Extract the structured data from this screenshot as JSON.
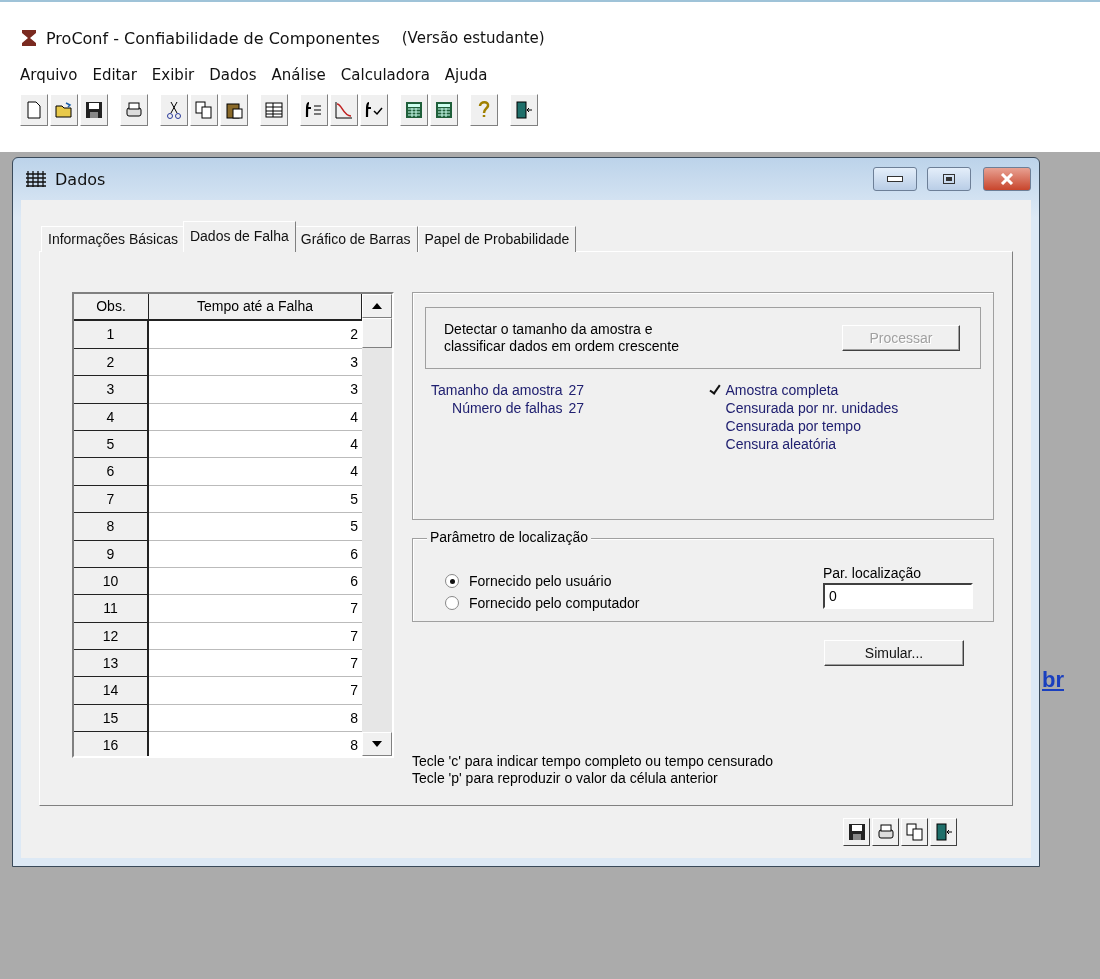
{
  "app": {
    "title": "ProConf - Confiabilidade de Componentes",
    "edition": "(Versão estudante)"
  },
  "menu": [
    "Arquivo",
    "Editar",
    "Exibir",
    "Dados",
    "Análise",
    "Calculadora",
    "Ajuda"
  ],
  "desktop_link": "br",
  "dialog": {
    "title": "Dados",
    "tabs": [
      {
        "label": "Informações Básicas",
        "selected": false
      },
      {
        "label": "Dados de Falha",
        "selected": true
      },
      {
        "label": "Gráfico de Barras",
        "selected": false
      },
      {
        "label": "Papel de Probabilidade",
        "selected": false
      }
    ],
    "table": {
      "columns": [
        "Obs.",
        "Tempo até a Falha"
      ],
      "rows": [
        [
          "1",
          "2"
        ],
        [
          "2",
          "3"
        ],
        [
          "3",
          "3"
        ],
        [
          "4",
          "4"
        ],
        [
          "5",
          "4"
        ],
        [
          "6",
          "4"
        ],
        [
          "7",
          "5"
        ],
        [
          "8",
          "5"
        ],
        [
          "9",
          "6"
        ],
        [
          "10",
          "6"
        ],
        [
          "11",
          "7"
        ],
        [
          "12",
          "7"
        ],
        [
          "13",
          "7"
        ],
        [
          "14",
          "7"
        ],
        [
          "15",
          "8"
        ],
        [
          "16",
          "8"
        ]
      ]
    },
    "detect": {
      "text": "Detectar o tamanho da amostra e classificar dados em ordem crescente",
      "button": {
        "label": "Processar",
        "disabled": true
      }
    },
    "stats": [
      {
        "label": "Tamanho da amostra",
        "value": "27"
      },
      {
        "label": "Número de falhas",
        "value": "27"
      }
    ],
    "sample_types": [
      {
        "label": "Amostra completa",
        "checked": true
      },
      {
        "label": "Censurada por nr. unidades",
        "checked": false
      },
      {
        "label": "Censurada por tempo",
        "checked": false
      },
      {
        "label": "Censura aleatória",
        "checked": false
      }
    ],
    "location": {
      "legend": "Parâmetro de localização",
      "options": [
        {
          "label": "Fornecido pelo usuário",
          "selected": true
        },
        {
          "label": "Fornecido pelo computador",
          "selected": false
        }
      ],
      "field_label": "Par. localização",
      "field_value": "0"
    },
    "simulate_button": "Simular...",
    "hints": [
      "Tecle 'c' para indicar tempo completo ou tempo censurado",
      "Tecle 'p' para reproduzir o valor da célula anterior"
    ]
  }
}
